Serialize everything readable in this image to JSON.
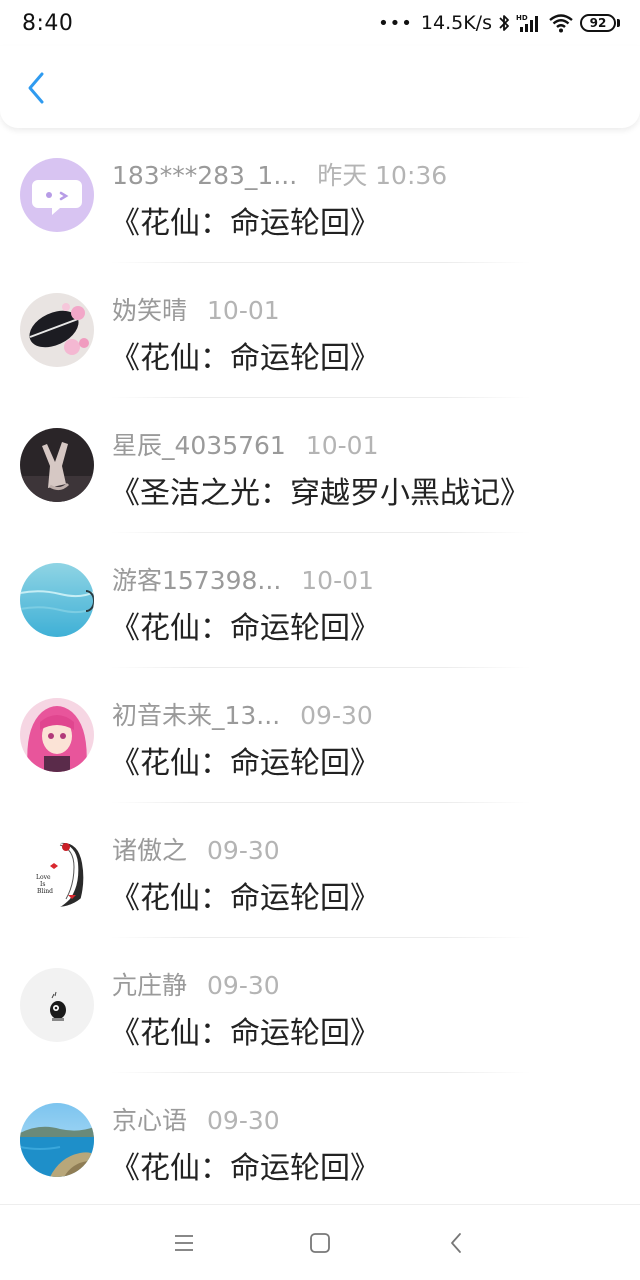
{
  "status_bar": {
    "time": "8:40",
    "dots": "•••",
    "network_speed": "14.5K/s",
    "battery": "92"
  },
  "header": {
    "back_icon": "chevron-left-icon",
    "accent_color": "#2f9bf0"
  },
  "items": [
    {
      "name": "183***283_1...",
      "time": "昨天 10:36",
      "title": "《花仙：命运轮回》",
      "avatar": "chat-bubble-avatar"
    },
    {
      "name": "妫笑晴",
      "time": "10-01",
      "title": "《花仙：命运轮回》",
      "avatar": "flowers-photo-avatar"
    },
    {
      "name": "星辰_4035761",
      "time": "10-01",
      "title": "《圣洁之光：穿越罗小黑战记》",
      "avatar": "hand-gesture-avatar"
    },
    {
      "name": "游客157398...",
      "time": "10-01",
      "title": "《花仙：命运轮回》",
      "avatar": "sea-photo-avatar"
    },
    {
      "name": "初音未来_13...",
      "time": "09-30",
      "title": "《花仙：命运轮回》",
      "avatar": "anime-girl-avatar"
    },
    {
      "name": "诸傲之",
      "time": "09-30",
      "title": "《花仙：命运轮回》",
      "avatar": "sketch-girl-avatar"
    },
    {
      "name": "亢庄静",
      "time": "09-30",
      "title": "《花仙：命运轮回》",
      "avatar": "small-character-avatar"
    },
    {
      "name": "京心语",
      "time": "09-30",
      "title": "《花仙：命运轮回》",
      "avatar": "coast-photo-avatar"
    }
  ],
  "nav_bar": {
    "buttons": [
      "menu-icon",
      "home-square-icon",
      "back-triangle-icon"
    ]
  }
}
